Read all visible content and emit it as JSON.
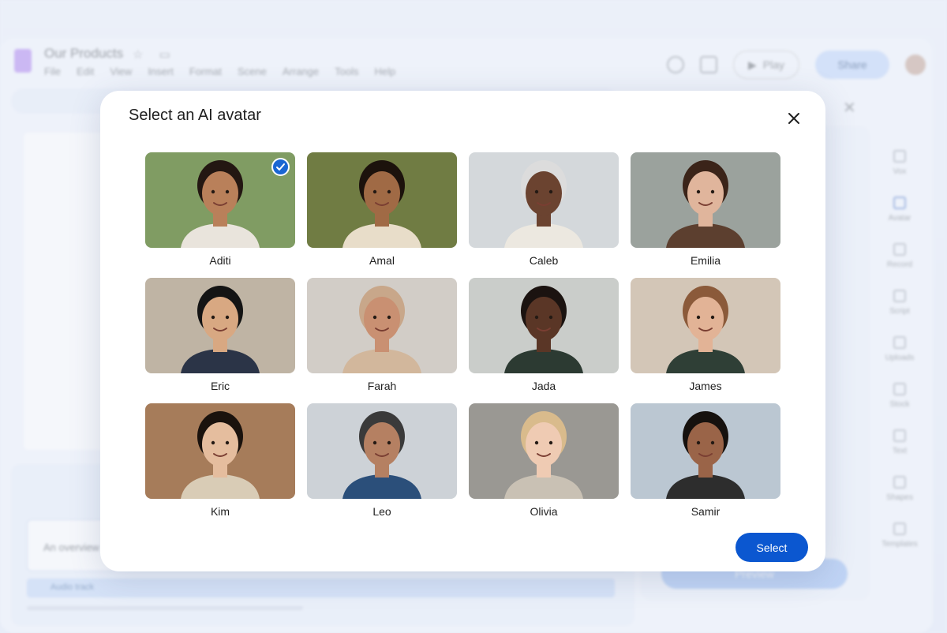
{
  "background_app": {
    "document_title": "Our Products",
    "menu": [
      "File",
      "Edit",
      "View",
      "Insert",
      "Format",
      "Scene",
      "Arrange",
      "Tools",
      "Help"
    ],
    "play_label": "Play",
    "share_label": "Share",
    "script_text": "An overview",
    "audio_track_label": "Audio track",
    "panel_button_label": "Preview",
    "side_rail": [
      "Vox",
      "Avatar",
      "Record",
      "Script",
      "Uploads",
      "Stock",
      "Text",
      "Shapes",
      "Templates"
    ],
    "colors": {
      "accent": "#0b57d0",
      "logo": "#b48cf0"
    }
  },
  "modal": {
    "title": "Select an AI avatar",
    "close_icon": "close-icon",
    "select_label": "Select",
    "avatars": [
      {
        "name": "Aditi",
        "selected": true,
        "bg": "#6f8f4e",
        "skin": "#b9805a",
        "hair": "#231712",
        "shirt": "#e9e4dc"
      },
      {
        "name": "Amal",
        "selected": false,
        "bg": "#5d6a2a",
        "skin": "#a06a45",
        "hair": "#1c120c",
        "shirt": "#e8ddc9"
      },
      {
        "name": "Caleb",
        "selected": false,
        "bg": "#cfd3d6",
        "skin": "#6b4330",
        "hair": "#dcdcdc",
        "shirt": "#ece8e0"
      },
      {
        "name": "Emilia",
        "selected": false,
        "bg": "#8e9690",
        "skin": "#e0b59c",
        "hair": "#3b2419",
        "shirt": "#5c3f2f"
      },
      {
        "name": "Eric",
        "selected": false,
        "bg": "#b7aa98",
        "skin": "#d8a882",
        "hair": "#141414",
        "shirt": "#2b3447"
      },
      {
        "name": "Farah",
        "selected": false,
        "bg": "#ccc7c0",
        "skin": "#c99072",
        "hair": "#c8a78a",
        "shirt": "#d2b79c"
      },
      {
        "name": "Jada",
        "selected": false,
        "bg": "#c3c6c3",
        "skin": "#5a3626",
        "hair": "#1b1310",
        "shirt": "#2c3a32"
      },
      {
        "name": "James",
        "selected": false,
        "bg": "#cdbfae",
        "skin": "#e2b396",
        "hair": "#8b5a3a",
        "shirt": "#2f3f36"
      },
      {
        "name": "Kim",
        "selected": false,
        "bg": "#9a6a44",
        "skin": "#e5bd9e",
        "hair": "#1a120d",
        "shirt": "#d9ccb6"
      },
      {
        "name": "Leo",
        "selected": false,
        "bg": "#c6ccd2",
        "skin": "#b58062",
        "hair": "#3a3a3a",
        "shirt": "#2b4f7a"
      },
      {
        "name": "Olivia",
        "selected": false,
        "bg": "#8c8a84",
        "skin": "#efcbb3",
        "hair": "#d9bb8c",
        "shirt": "#c9c1b4"
      },
      {
        "name": "Samir",
        "selected": false,
        "bg": "#b2c0cc",
        "skin": "#9a6448",
        "hair": "#16110e",
        "shirt": "#2d2d2d"
      }
    ]
  }
}
